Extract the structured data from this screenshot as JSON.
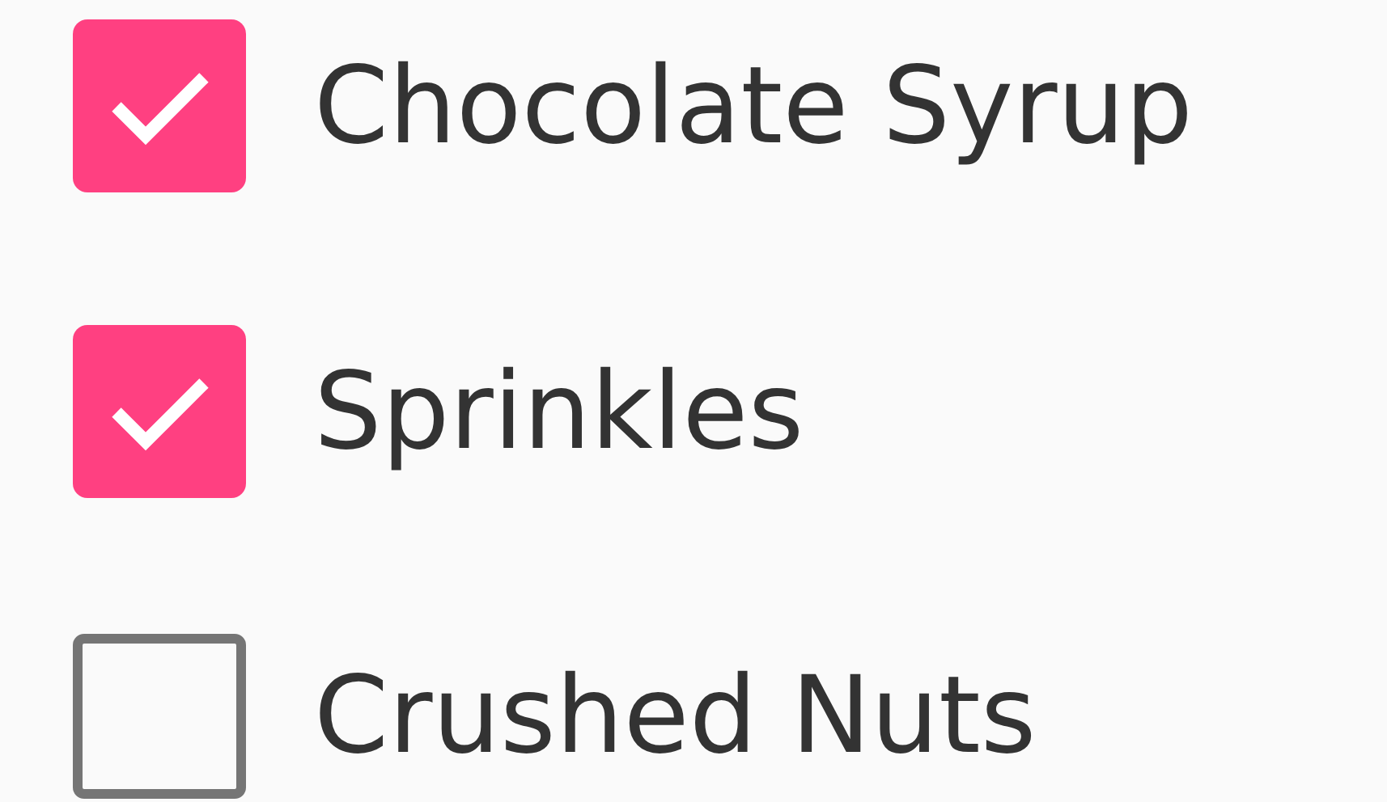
{
  "checkboxes": [
    {
      "label": "Chocolate Syrup",
      "checked": true
    },
    {
      "label": "Sprinkles",
      "checked": true
    },
    {
      "label": "Crushed Nuts",
      "checked": false
    }
  ]
}
